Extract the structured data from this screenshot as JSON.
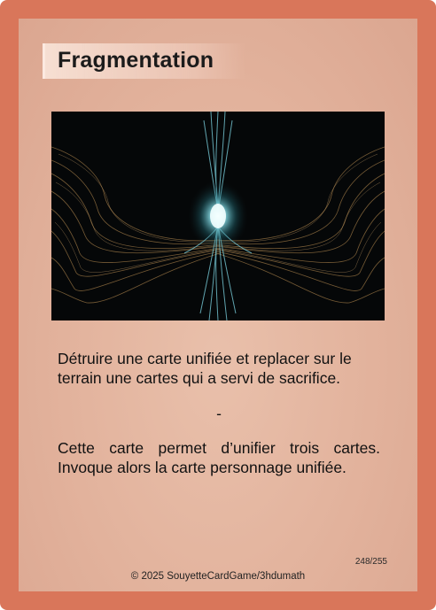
{
  "card": {
    "title": "Fragmentation",
    "illustration": "abstract dark fractal with glowing cyan center",
    "rules_line1": "Détruire une carte unifiée et replacer sur le terrain une cartes qui a servi de sacrifice.",
    "separator": "-",
    "rules_line2": "Cette carte permet d’unifier trois cartes. Invoque alors la carte personnage unifiée.",
    "card_number": "248/255",
    "copyright": "© 2025 SouyetteCardGame/3hdumath"
  },
  "colors": {
    "frame": "#d9765a",
    "panel": "#e6b8a3",
    "glow": "#bff6ff"
  }
}
